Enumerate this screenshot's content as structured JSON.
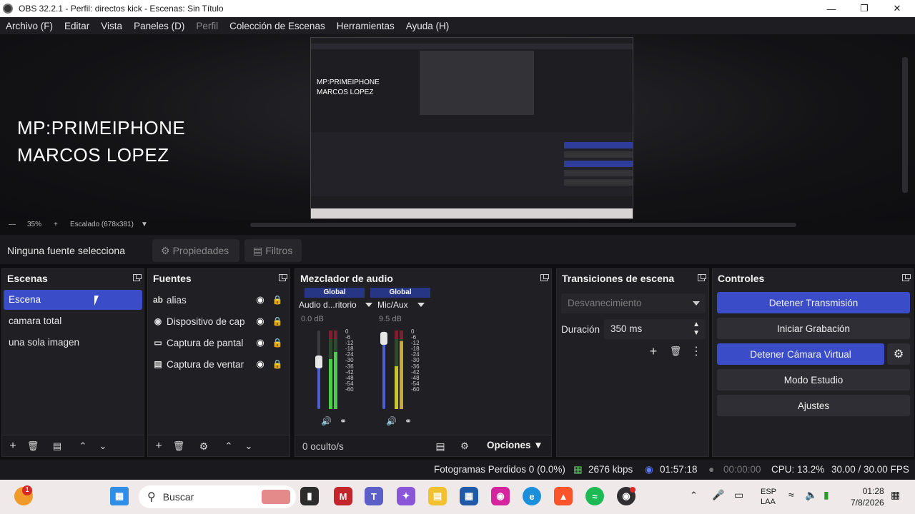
{
  "window": {
    "title": "OBS 32.2.1 - Perfil: directos kick - Escenas: Sin Título"
  },
  "menu": [
    "Archivo (F)",
    "Editar",
    "Vista",
    "Paneles (D)",
    "Perfil",
    "Colección de Escenas",
    "Herramientas",
    "Ayuda (H)"
  ],
  "preview": {
    "overlay_line1": "MP:PRIMEIPHONE",
    "overlay_line2": "MARCOS LOPEZ",
    "zoom": "35%",
    "scale_label": "Escalado (678x381)"
  },
  "properties_bar": {
    "no_selection": "Ninguna fuente selecciona",
    "properties_label": "Propiedades",
    "filters_label": "Filtros"
  },
  "scenes": {
    "title": "Escenas",
    "items": [
      "Escena",
      "camara total",
      "una sola imagen"
    ],
    "selected": "Escena"
  },
  "sources": {
    "title": "Fuentes",
    "items": [
      {
        "label": "alias",
        "icon": "text-icon"
      },
      {
        "label": "Dispositivo de cap",
        "icon": "camera-icon"
      },
      {
        "label": "Captura de pantal",
        "icon": "monitor-icon"
      },
      {
        "label": "Captura de ventar",
        "icon": "window-icon"
      }
    ]
  },
  "mixer": {
    "title": "Mezclador de audio",
    "channels": [
      {
        "scope": "Global",
        "name": "Audio d...ritorio",
        "db": "0.0 dB",
        "level": 0.6
      },
      {
        "scope": "Global",
        "name": "Mic/Aux",
        "db": "9.5 dB",
        "level": 0.9
      }
    ],
    "scale": [
      "0",
      "-6",
      "-12",
      "-18",
      "-24",
      "-30",
      "-36",
      "-42",
      "-48",
      "-54",
      "-60"
    ],
    "hidden": "0 oculto/s",
    "options": "Opciones"
  },
  "transitions": {
    "title": "Transiciones de escena",
    "selected": "Desvanecimiento",
    "duration_label": "Duración",
    "duration_value": "350 ms"
  },
  "controls": {
    "title": "Controles",
    "stop_stream": "Detener Transmisión",
    "start_record": "Iniciar Grabación",
    "stop_virtualcam": "Detener Cámara Virtual",
    "studio_mode": "Modo Estudio",
    "settings": "Ajustes"
  },
  "status": {
    "dropped": "Fotogramas Perdidos 0 (0.0%)",
    "bitrate": "2676 kbps",
    "stream_time": "01:57:18",
    "record_time": "00:00:00",
    "cpu": "CPU: 13.2%",
    "fps": "30.00 / 30.00 FPS"
  },
  "taskbar": {
    "search_placeholder": "Buscar",
    "notification_badge": "1",
    "lang_line1": "ESP",
    "lang_line2": "LAA",
    "time": "01:28",
    "date": "7/8/2026"
  },
  "colors": {
    "accent": "#3a4cc7",
    "panel": "#1f1f24",
    "background": "#0f0f12"
  }
}
